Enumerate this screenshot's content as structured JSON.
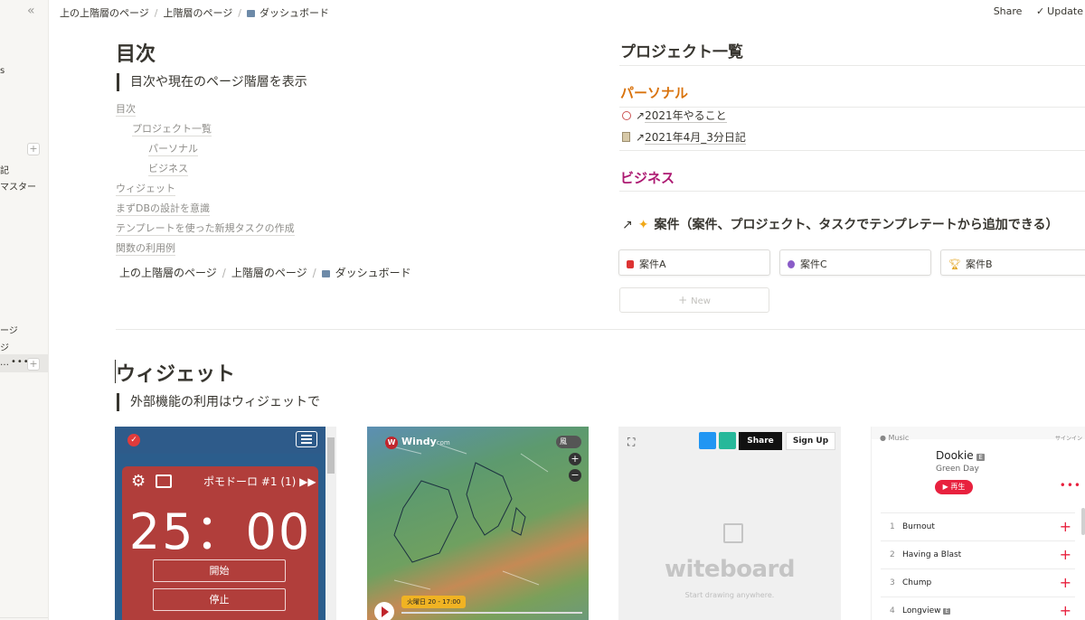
{
  "sidebar": {
    "collapse_icon": "«",
    "items": [
      {
        "label": "s"
      },
      {
        "label": "記"
      },
      {
        "label": "マスター"
      },
      {
        "label": "ージ"
      },
      {
        "label": "ジ"
      },
      {
        "label": "…"
      }
    ],
    "more_icon": "•••",
    "plus_icon": "+"
  },
  "topbar": {
    "breadcrumbs": [
      "上の上階層のページ",
      "上階層のページ",
      "ダッシュボード"
    ],
    "separator": "/",
    "share_label": "Share",
    "update_label": "Update"
  },
  "toc": {
    "heading": "目次",
    "quote": "目次や現在のページ階層を表示",
    "links": [
      "目次",
      "プロジェクト一覧",
      "パーソナル",
      "ビジネス",
      "ウィジェット",
      "まずDBの設計を意識",
      "テンプレートを使った新規タスクの作成",
      "関数の利用例"
    ],
    "breadcrumbs": [
      "上の上階層のページ",
      "上階層のページ",
      "ダッシュボード"
    ]
  },
  "projects": {
    "heading": "プロジェクト一覧",
    "personal_heading": "パーソナル",
    "personal_links": [
      "2021年やること",
      "2021年4月_3分日記"
    ],
    "business_heading": "ビジネス",
    "case_heading": "案件（案件、プロジェクト、タスクでテンプレテートから追加できる）",
    "cards": [
      "案件A",
      "案件C",
      "案件B"
    ],
    "new_label": "New"
  },
  "widgets": {
    "heading": "ウィジェット",
    "quote": "外部機能の利用はウィジェットで",
    "pomodoro": {
      "title": "ポモドーロ #1 (1) ▶▶",
      "time": "25：00",
      "start_label": "開始",
      "stop_label": "停止"
    },
    "windy": {
      "logo": "Windy",
      "logo_suffix": "com",
      "wind_label": "風",
      "zoom_in": "+",
      "zoom_out": "−",
      "time_label": "火曜日 20 - 17:00"
    },
    "witeboard": {
      "share_label": "Share",
      "signup_label": "Sign Up",
      "logo": "witeboard",
      "tagline": "Start drawing anywhere."
    },
    "music": {
      "brand": "Music",
      "signin": "サインイン",
      "album": "Dookie",
      "explicit": "E",
      "artist": "Green Day",
      "play_label": "▶ 再生",
      "more": "•••",
      "tracks": [
        {
          "num": "1",
          "title": "Burnout"
        },
        {
          "num": "2",
          "title": "Having a Blast"
        },
        {
          "num": "3",
          "title": "Chump"
        },
        {
          "num": "4",
          "title": "Longview"
        }
      ]
    }
  },
  "colors": {
    "personal": "#d9730d",
    "business": "#ad1a72",
    "pomodoro_red": "#b13e3b",
    "music_red": "#e8213e"
  }
}
